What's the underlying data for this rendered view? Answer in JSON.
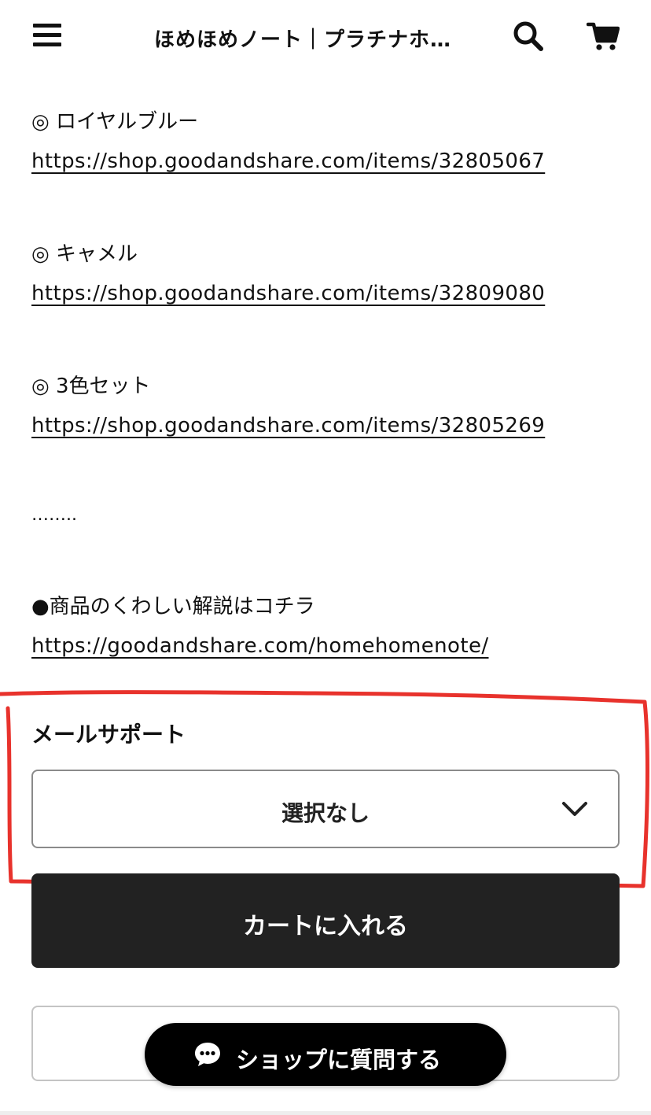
{
  "header": {
    "title": "ほめほめノート｜プラチナホ…",
    "menu_icon": "hamburger-menu-icon",
    "search_icon": "search-icon",
    "cart_icon": "cart-icon"
  },
  "description": {
    "items": [
      {
        "label": "◎ ロイヤルブルー",
        "url": "https://shop.goodandshare.com/items/32805067"
      },
      {
        "label": "◎ キャメル",
        "url": "https://shop.goodandshare.com/items/32809080"
      },
      {
        "label": "◎ 3色セット",
        "url": "https://shop.goodandshare.com/items/32805269"
      }
    ],
    "ellipsis": "……..",
    "detail_label": "●商品のくわしい解説はコチラ",
    "detail_url": "https://goodandshare.com/homehomenote/"
  },
  "option": {
    "label": "メールサポート",
    "selected_value": "選択なし",
    "dropdown_icon": "chevron-down-icon"
  },
  "actions": {
    "add_to_cart_label": "カートに入れる",
    "ask_shop_label": "ショップに質問する",
    "chat_icon": "chat-bubble-icon"
  },
  "colors": {
    "annotation_red": "#e8322c",
    "button_dark": "#222222",
    "chat_button": "#000000"
  }
}
